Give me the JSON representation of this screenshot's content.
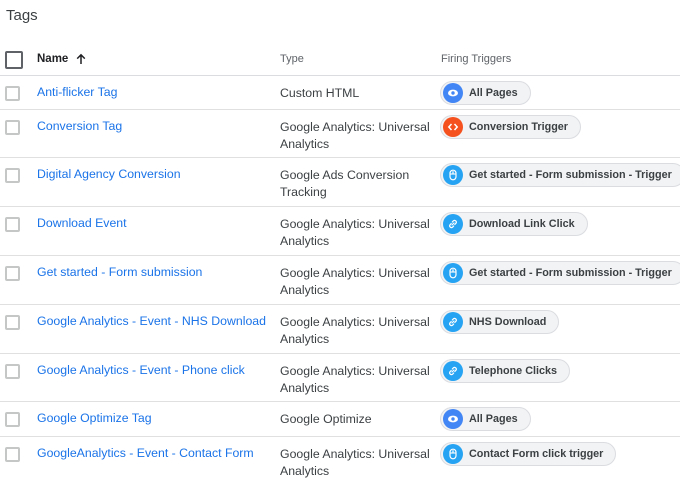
{
  "page": {
    "title": "Tags"
  },
  "columns": {
    "name": "Name",
    "type": "Type",
    "triggers": "Firing Triggers"
  },
  "colors": {
    "pageview": "#4285f4",
    "custom": "#f4511e",
    "click": "#26a3f2",
    "link": "#26a3f2"
  },
  "rows": [
    {
      "name": "Anti-flicker Tag",
      "type": "Custom HTML",
      "trigger": "All Pages",
      "trigger_icon": "eye-icon"
    },
    {
      "name": "Conversion Tag",
      "type": "Google Analytics: Universal Analytics",
      "trigger": "Conversion Trigger",
      "trigger_icon": "code-icon"
    },
    {
      "name": "Digital Agency Conversion",
      "type": "Google Ads Conversion Tracking",
      "trigger": "Get started - Form submission - Trigger",
      "trigger_icon": "mouse-icon"
    },
    {
      "name": "Download Event",
      "type": "Google Analytics: Universal Analytics",
      "trigger": "Download Link Click",
      "trigger_icon": "link-icon"
    },
    {
      "name": "Get started - Form submission",
      "type": "Google Analytics: Universal Analytics",
      "trigger": "Get started - Form submission - Trigger",
      "trigger_icon": "mouse-icon"
    },
    {
      "name": "Google Analytics - Event - NHS Download",
      "type": "Google Analytics: Universal Analytics",
      "trigger": "NHS Download",
      "trigger_icon": "link-icon"
    },
    {
      "name": "Google Analytics - Event - Phone click",
      "type": "Google Analytics: Universal Analytics",
      "trigger": "Telephone Clicks",
      "trigger_icon": "link-icon"
    },
    {
      "name": "Google Optimize Tag",
      "type": "Google Optimize",
      "trigger": "All Pages",
      "trigger_icon": "eye-icon"
    },
    {
      "name": "GoogleAnalytics - Event - Contact Form",
      "type": "Google Analytics: Universal Analytics",
      "trigger": "Contact Form click trigger",
      "trigger_icon": "mouse-icon"
    }
  ]
}
